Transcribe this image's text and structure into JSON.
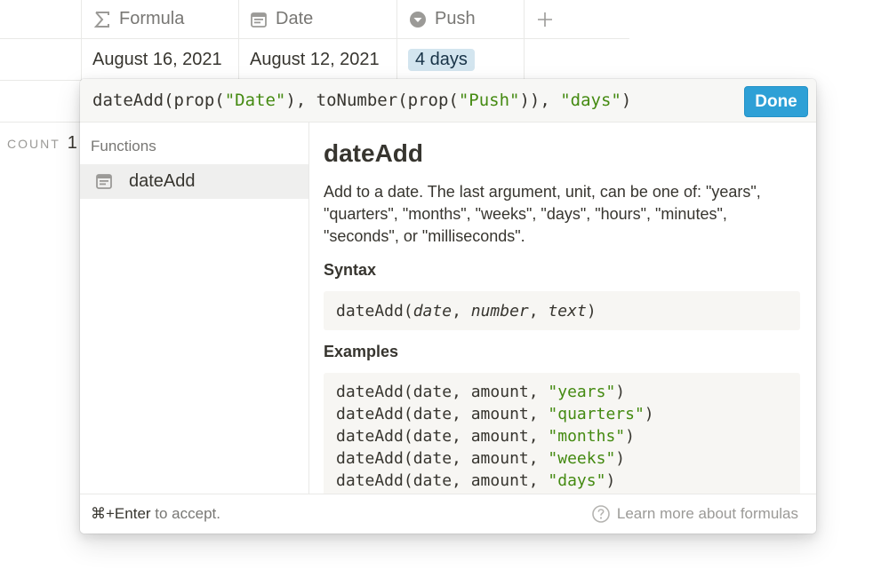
{
  "table": {
    "columns": [
      {
        "label": "Formula",
        "icon": "sigma-icon"
      },
      {
        "label": "Date",
        "icon": "calendar-icon"
      },
      {
        "label": "Push",
        "icon": "select-icon"
      }
    ],
    "row": {
      "formula": "August 16, 2021",
      "date": "August 12, 2021",
      "push": "4 days"
    },
    "count_label": "COUNT",
    "count_value": "1"
  },
  "popup": {
    "formula_parts": [
      "dateAdd(prop(",
      "\"Date\"",
      "), toNumber(prop(",
      "\"Push\"",
      ")), ",
      "\"days\"",
      ")"
    ],
    "done_label": "Done",
    "functions_label": "Functions",
    "function_item": "dateAdd",
    "doc": {
      "title": "dateAdd",
      "description": "Add to a date. The last argument, unit, can be one of: \"years\", \"quarters\", \"months\", \"weeks\", \"days\", \"hours\", \"minutes\", \"seconds\", or \"milliseconds\".",
      "syntax_heading": "Syntax",
      "syntax": {
        "fn": "dateAdd(",
        "a1": "date",
        "sep1": ", ",
        "a2": "number",
        "sep2": ", ",
        "a3": "text",
        "close": ")"
      },
      "examples_heading": "Examples",
      "examples": [
        {
          "prefix": "dateAdd(date, amount, ",
          "unit": "\"years\"",
          "suffix": ")"
        },
        {
          "prefix": "dateAdd(date, amount, ",
          "unit": "\"quarters\"",
          "suffix": ")"
        },
        {
          "prefix": "dateAdd(date, amount, ",
          "unit": "\"months\"",
          "suffix": ")"
        },
        {
          "prefix": "dateAdd(date, amount, ",
          "unit": "\"weeks\"",
          "suffix": ")"
        },
        {
          "prefix": "dateAdd(date, amount, ",
          "unit": "\"days\"",
          "suffix": ")"
        }
      ]
    },
    "footer": {
      "shortcut": "⌘+Enter",
      "hint_suffix": " to accept.",
      "learn_more": "Learn more about formulas"
    }
  },
  "colors": {
    "accent": "#2ea0d6",
    "string": "#448a11",
    "tag_bg": "#d3e5ef"
  }
}
